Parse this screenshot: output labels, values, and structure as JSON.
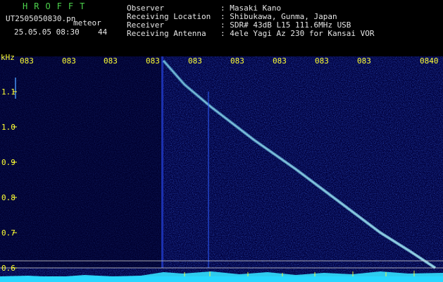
{
  "header": {
    "app_title": "HROFFT",
    "filename": "UT2505050830.pn",
    "mode": "meteor",
    "date_time": "25.05.05 08:30",
    "count": "44",
    "fields": [
      {
        "label": "Observer",
        "value": ": Masaki Kano"
      },
      {
        "label": "Receiving Location",
        "value": ": Shibukawa, Gunma, Japan"
      },
      {
        "label": "Receiver",
        "value": ": SDR# 43dB L15 111.6MHz USB"
      },
      {
        "label": "Receiving Antenna",
        "value": ": 4ele Yagi Az 230 for Kansai VOR"
      }
    ]
  },
  "spectrogram": {
    "unit_label": "kHz",
    "y_ticks": [
      "1.1",
      "1.0",
      "0.9",
      "0.8",
      "0.7",
      "0.6"
    ],
    "x_ticks": [
      "083",
      "083",
      "083",
      "083",
      "083",
      "083",
      "083",
      "083",
      "083",
      "0840"
    ],
    "colors": {
      "background": "#00004a",
      "trace": "#33d0ff",
      "axis": "#ffff33",
      "noise": "#00c8ff"
    }
  }
}
